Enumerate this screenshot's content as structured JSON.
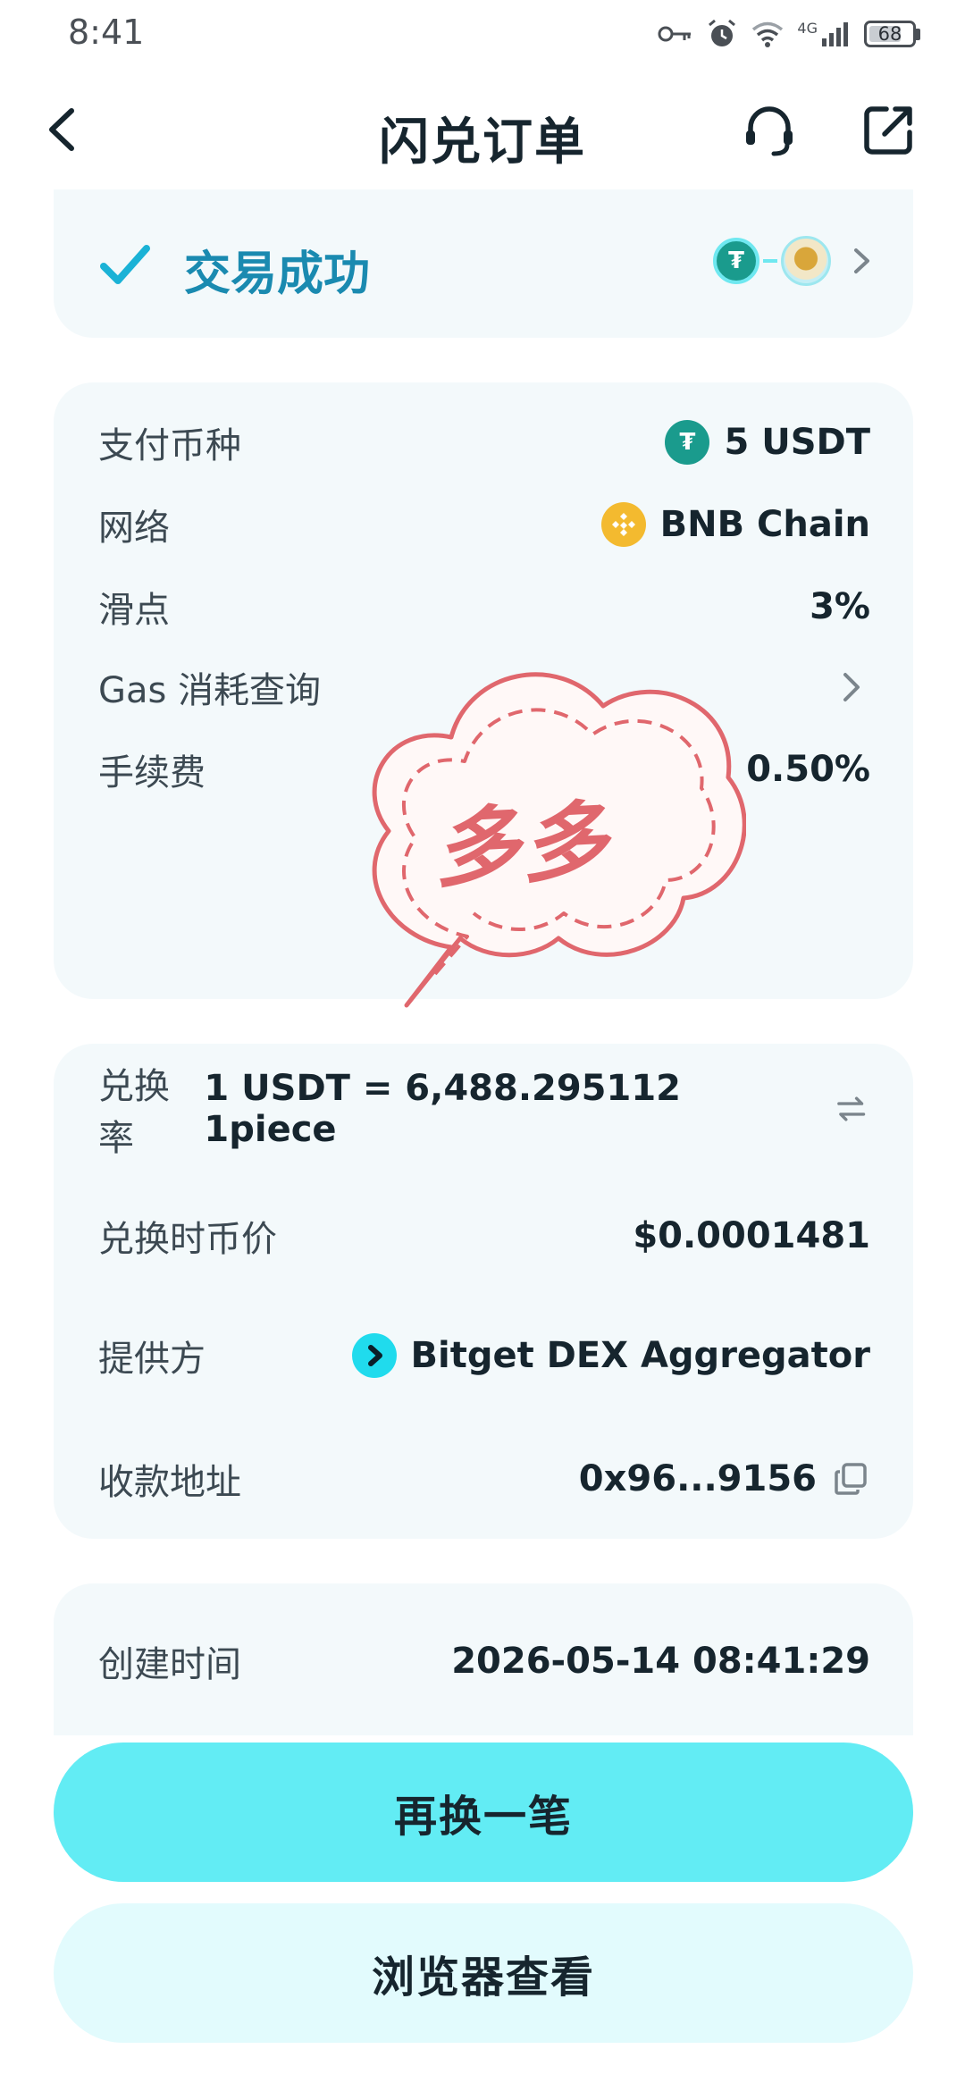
{
  "status_bar": {
    "time": "8:41",
    "network_label": "4G",
    "battery": "68"
  },
  "header": {
    "title": "闪兑订单"
  },
  "status_card": {
    "text": "交易成功"
  },
  "card1": {
    "rows": [
      {
        "label": "支付币种",
        "value": "5 USDT"
      },
      {
        "label": "网络",
        "value": "BNB Chain"
      },
      {
        "label": "滑点",
        "value": "3%"
      },
      {
        "label": "Gas 消耗查询",
        "value": ""
      },
      {
        "label": "手续费",
        "value": "0.50%"
      }
    ]
  },
  "card2": {
    "rows": [
      {
        "label": "兑换率",
        "value": "1 USDT = 6,488.295112 1piece"
      },
      {
        "label": "兑换时币价",
        "value": "$0.0001481"
      },
      {
        "label": "提供方",
        "value": "Bitget DEX Aggregator"
      },
      {
        "label": "收款地址",
        "value": "0x96...9156"
      }
    ]
  },
  "card3": {
    "rows": [
      {
        "label": "创建时间",
        "value": "2026-05-14 08:41:29"
      }
    ]
  },
  "sticker": {
    "text": "多多"
  },
  "buttons": {
    "primary": "再换一笔",
    "secondary": "浏览器查看"
  },
  "colors": {
    "accent": "#62ecf4",
    "success": "#1a8ab0",
    "usdt": "#1a9b8d",
    "bnb": "#f3ba2f",
    "sticker": "#e0676d"
  },
  "icons": {
    "usdt": "usdt-icon",
    "bnb": "bnb-icon",
    "bitget": "bitget-icon"
  }
}
